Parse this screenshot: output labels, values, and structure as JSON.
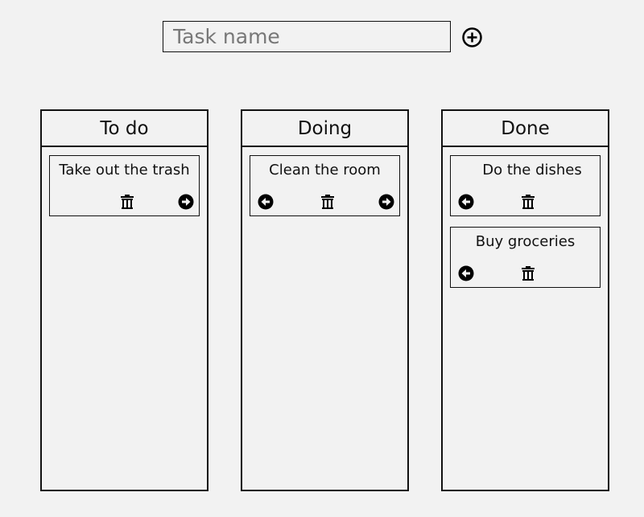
{
  "new_task": {
    "placeholder": "Task name",
    "value": "",
    "add_icon": "plus-circle-icon"
  },
  "columns": [
    {
      "title": "To do",
      "cards": [
        {
          "title": "Take out the trash",
          "actions": [
            "trash-icon",
            "arrow-right-circle-icon"
          ]
        }
      ]
    },
    {
      "title": "Doing",
      "cards": [
        {
          "title": "Clean the room",
          "actions": [
            "arrow-left-circle-icon",
            "trash-icon",
            "arrow-right-circle-icon"
          ]
        }
      ]
    },
    {
      "title": "Done",
      "cards": [
        {
          "title": "Do the dishes",
          "actions": [
            "arrow-left-circle-icon",
            "trash-icon"
          ]
        },
        {
          "title": "Buy groceries",
          "actions": [
            "arrow-left-circle-icon",
            "trash-icon"
          ]
        }
      ]
    }
  ]
}
